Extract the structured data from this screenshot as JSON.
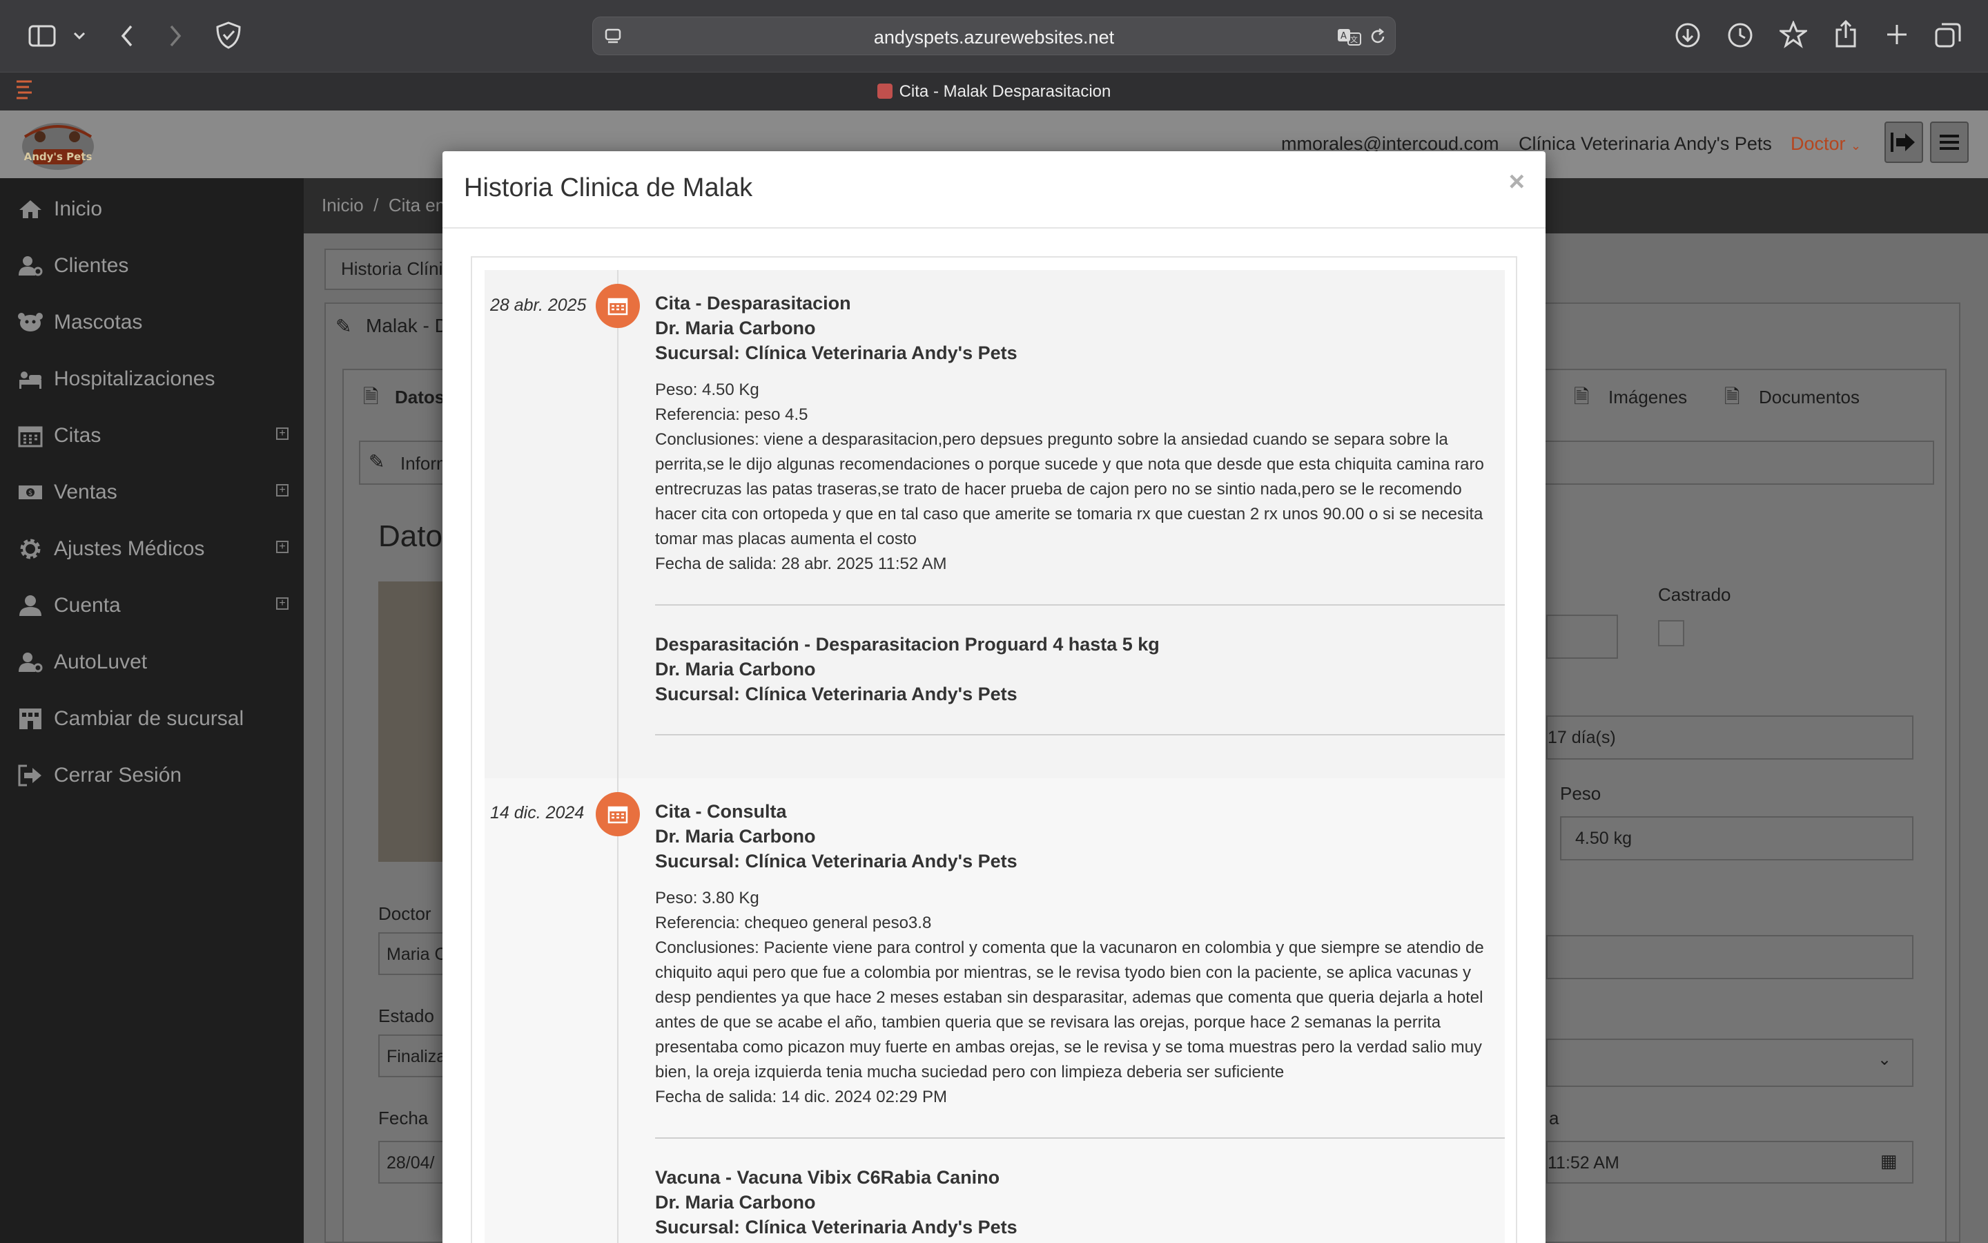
{
  "browser": {
    "url": "andyspets.azurewebsites.net",
    "tab_title": "Cita - Malak Desparasitacion"
  },
  "header": {
    "email": "mmorales@intercoud.com",
    "clinic": "Clínica Veterinaria Andy's Pets",
    "role": "Doctor",
    "logo_text": "Andy's Pets"
  },
  "sidebar": {
    "items": [
      {
        "label": "Inicio",
        "icon": "home-icon"
      },
      {
        "label": "Clientes",
        "icon": "user-gear-icon"
      },
      {
        "label": "Mascotas",
        "icon": "paw-icon"
      },
      {
        "label": "Hospitalizaciones",
        "icon": "bed-icon"
      },
      {
        "label": "Citas",
        "icon": "calendar-icon"
      },
      {
        "label": "Ventas",
        "icon": "money-icon"
      },
      {
        "label": "Ajustes Médicos",
        "icon": "gear-icon"
      },
      {
        "label": "Cuenta",
        "icon": "user-icon"
      },
      {
        "label": "AutoLuvet",
        "icon": "user-gear-icon"
      },
      {
        "label": "Cambiar de sucursal",
        "icon": "building-icon"
      },
      {
        "label": "Cerrar Sesión",
        "icon": "sign-out-icon"
      }
    ]
  },
  "background": {
    "breadcrumb_home": "Inicio",
    "breadcrumb_sep": "/",
    "breadcrumb_current": "Cita en",
    "history_button": "Historia Clíni",
    "panel_title": "Malak - D",
    "tab_datos": "Datos",
    "tab_imagenes": "Imágenes",
    "tab_documentos": "Documentos",
    "info_panel": "Inform",
    "datos_heading": "Datos",
    "castrado_label": "Castrado",
    "age_value": "17 día(s)",
    "peso_label": "Peso",
    "peso_value": "4.50 kg",
    "doctor_label": "Doctor",
    "doctor_value": "Maria C",
    "estado_label": "Estado",
    "estado_value": "Finaliza",
    "fecha_label": "Fecha",
    "fecha_value": "28/04/",
    "hora_label": "a",
    "hora_value": "11:52 AM"
  },
  "modal": {
    "title": "Historia Clinica de Malak",
    "close": "×",
    "entries": [
      {
        "date": "28 abr. 2025",
        "title": "Cita - Desparasitacion",
        "doctor": "Dr. Maria Carbono",
        "branch": "Sucursal: Clínica Veterinaria Andy's Pets",
        "peso": "Peso: 4.50 Kg",
        "referencia": "Referencia: peso 4.5",
        "conclusiones_lines": [
          "Conclusiones: viene a desparasitacion,pero depsues pregunto sobre la ansiedad cuando se separa sobre la",
          "perrita,se le dijo algunas recomendaciones o porque sucede y que nota que desde que esta chiquita camina raro",
          "entrecruzas las patas traseras,se trato de hacer prueba de cajon pero no se sintio nada,pero se le recomendo",
          "hacer cita con ortopeda y que en tal caso que amerite se tomaria rx que cuestan 2 rx unos 90.00 o si se necesita",
          "tomar mas placas aumenta el costo"
        ],
        "salida": "Fecha de salida: 28 abr. 2025 11:52 AM",
        "sub": {
          "title": "Desparasitación - Desparasitacion Proguard 4 hasta 5 kg",
          "doctor": "Dr. Maria Carbono",
          "branch": "Sucursal: Clínica Veterinaria Andy's Pets"
        }
      },
      {
        "date": "14 dic. 2024",
        "title": "Cita - Consulta",
        "doctor": "Dr. Maria Carbono",
        "branch": "Sucursal: Clínica Veterinaria Andy's Pets",
        "peso": "Peso: 3.80 Kg",
        "referencia": "Referencia: chequeo general peso3.8",
        "conclusiones_lines": [
          "Conclusiones: Paciente viene para control y comenta que la vacunaron en colombia y que siempre se atendio de",
          "chiquito aqui pero que fue a colombia por mientras, se le revisa tyodo bien con la paciente, se aplica vacunas y",
          "desp pendientes ya que hace 2 meses estaban sin desparasitar, ademas que comenta que queria dejarla a hotel",
          "antes de que se acabe el año, tambien queria que se revisara las orejas, porque hace 2 semanas la perrita",
          "presentaba como picazon muy fuerte en ambas orejas, se le revisa y se toma muestras pero la verdad salio muy",
          "bien, la oreja izquierda tenia mucha suciedad pero con limpieza deberia ser suficiente"
        ],
        "salida": "Fecha de salida: 14 dic. 2024 02:29 PM",
        "sub": {
          "title": "Vacuna - Vacuna Vibix C6Rabia Canino",
          "doctor": "Dr. Maria Carbono",
          "branch": "Sucursal: Clínica Veterinaria Andy's Pets"
        }
      }
    ]
  },
  "colors": {
    "accent": "#e8703f",
    "sidebar_bg": "#1e1e1e",
    "role": "#b5461f"
  }
}
